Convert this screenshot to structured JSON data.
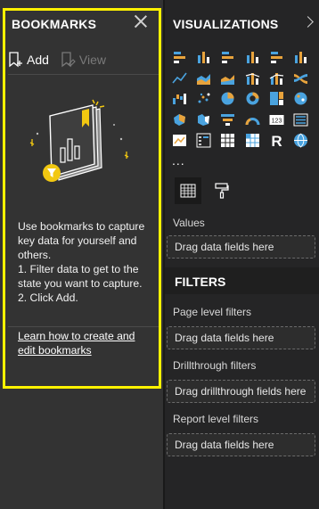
{
  "bookmarks": {
    "title": "BOOKMARKS",
    "add_label": "Add",
    "view_label": "View",
    "help_lines": [
      "Use bookmarks to capture",
      "key data for yourself and",
      "others.",
      "1. Filter data to get to the",
      "state you want to capture.",
      "2. Click Add."
    ],
    "learn_link_lines": [
      "Learn how to create and",
      "edit bookmarks"
    ]
  },
  "visualizations": {
    "title": "VISUALIZATIONS",
    "more_label": "...",
    "icons": [
      "stacked-bar-chart-icon",
      "stacked-column-chart-icon",
      "clustered-bar-chart-icon",
      "clustered-column-chart-icon",
      "100-percent-stacked-bar-chart-icon",
      "100-percent-stacked-column-chart-icon",
      "line-chart-icon",
      "area-chart-icon",
      "stacked-area-chart-icon",
      "line-and-stacked-column-chart-icon",
      "line-and-clustered-column-chart-icon",
      "ribbon-chart-icon",
      "waterfall-chart-icon",
      "scatter-chart-icon",
      "pie-chart-icon",
      "donut-chart-icon",
      "treemap-icon",
      "map-icon",
      "filled-map-icon",
      "shape-map-icon",
      "funnel-icon",
      "gauge-icon",
      "card-icon",
      "multi-row-card-icon",
      "kpi-icon",
      "slicer-icon",
      "table-icon",
      "matrix-icon",
      "r-script-visual-icon",
      "globe-icon"
    ]
  },
  "fields": {
    "values_label": "Values",
    "values_drop": "Drag data fields here"
  },
  "filters": {
    "title": "FILTERS",
    "page_label": "Page level filters",
    "page_drop": "Drag data fields here",
    "drillthrough_label": "Drillthrough filters",
    "drillthrough_drop": "Drag drillthrough fields here",
    "report_label": "Report level filters",
    "report_drop": "Drag data fields here"
  },
  "colors": {
    "highlight": "#fff200",
    "accent_yellow": "#f2c811",
    "pane_bg": "#333333",
    "viz_bg": "#252526"
  }
}
